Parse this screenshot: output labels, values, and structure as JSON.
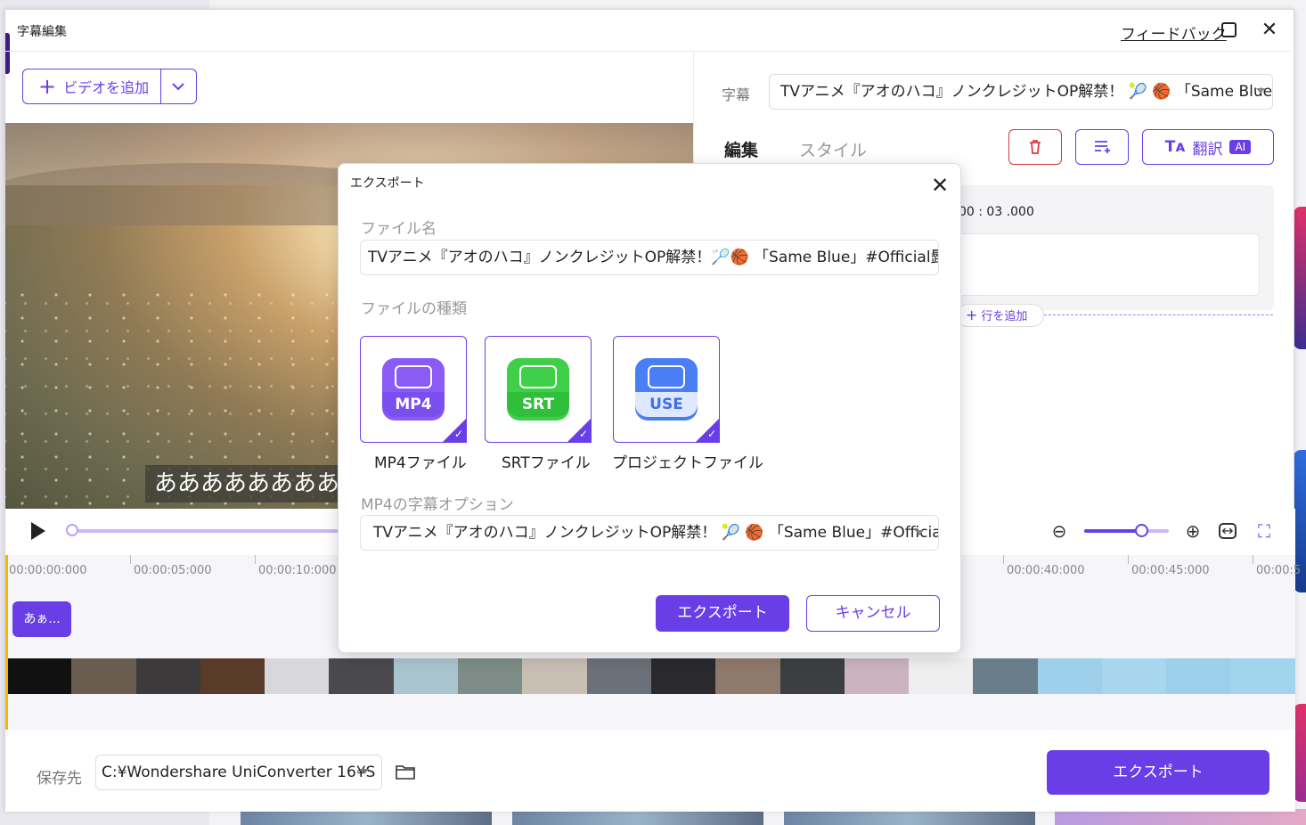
{
  "window": {
    "title": "字幕編集",
    "feedback_label": "フィードバック"
  },
  "left": {
    "add_video_label": "ビデオを追加",
    "subtitle_overlay": "ああああああああああ"
  },
  "timeline": {
    "ticks": [
      "00:00:00:000",
      "00:00:05:000",
      "00:00:10:000",
      "00:00:40:000",
      "00:00:45:000",
      "00:00:5"
    ],
    "clip_label": "あぁ..."
  },
  "right": {
    "subtitle_label": "字幕",
    "subtitle_value": "TVアニメ『アオのハコ』ノンクレジットOP解禁！ 🎾 🏀 「Same Blue」#O...",
    "tabs": [
      "編集",
      "スタイル"
    ],
    "translate_label": "翻訳",
    "ai_badge": "AI",
    "time_text": "00 : 03 .000",
    "add_row_label": "行を追加"
  },
  "footer": {
    "save_label": "保存先",
    "save_path": "C:¥Wondershare UniConverter 16¥S",
    "export_label": "エクスポート"
  },
  "dialog": {
    "title": "エクスポート",
    "filename_label": "ファイル名",
    "filename_value": "TVアニメ『アオのハコ』ノンクレジットOP解禁！🏸🏀 「Same Blue」#Official髭男dism",
    "filetype_label": "ファイルの種類",
    "file_types": [
      {
        "logo": "MP4",
        "name": "MP4ファイル",
        "color": "#7b4ef0"
      },
      {
        "logo": "SRT",
        "name": "SRTファイル",
        "color": "#2fbf3a"
      },
      {
        "logo": "USE",
        "name": "プロジェクトファイル",
        "color": "#3a6ff0"
      }
    ],
    "option_label": "MP4の字幕オプション",
    "option_value": "TVアニメ『アオのハコ』ノンクレジットOP解禁！ 🎾 🏀 「Same Blue」#Official髭...",
    "export_button": "エクスポート",
    "cancel_button": "キャンセル"
  },
  "colors": {
    "accent": "#6a3ee6",
    "delete": "#d63b3b",
    "playhead": "#f0b800"
  }
}
